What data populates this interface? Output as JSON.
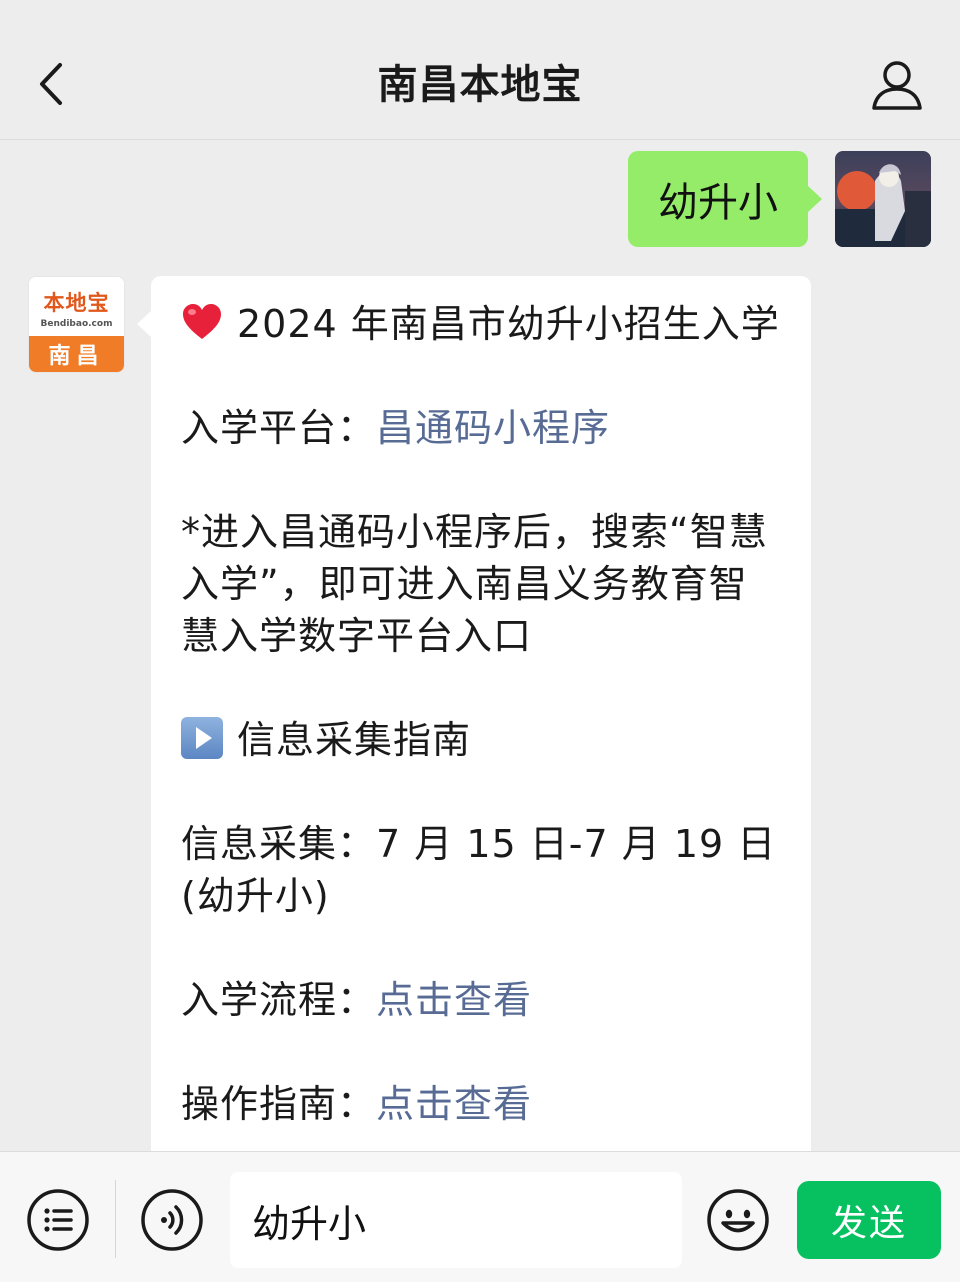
{
  "nav": {
    "title": "南昌本地宝"
  },
  "chat": {
    "user_message": "幼升小",
    "bot_avatar": {
      "name": "本地宝",
      "domain": "Bendibao.com",
      "city": "南昌"
    },
    "bot_message": {
      "title": "2024 年南昌市幼升小招生入学",
      "platform_label": "入学平台：",
      "platform_link": "昌通码小程序",
      "note_line1": "*进入昌通码小程序后，搜索“智慧",
      "note_line2": "入学”，即可进入南昌义务教育智",
      "note_line3": "慧入学数字平台入口",
      "section_title": "信息采集指南",
      "collect_label": "信息采集：",
      "collect_dates": "7 月 15 日-7 月 19 日",
      "collect_note": "(幼升小)",
      "process_label": "入学流程：",
      "process_link": "点击查看",
      "guide_label": "操作指南：",
      "guide_link": "点击查看"
    }
  },
  "input_bar": {
    "input_value": "幼升小",
    "send_label": "发送"
  },
  "colors": {
    "background": "#ededed",
    "user_bubble": "#95ec69",
    "link": "#576b95",
    "send_button": "#07c160"
  },
  "icons": [
    "back-icon",
    "profile-icon",
    "heart-icon",
    "play-icon",
    "menu-icon",
    "voice-icon",
    "emoji-icon"
  ]
}
